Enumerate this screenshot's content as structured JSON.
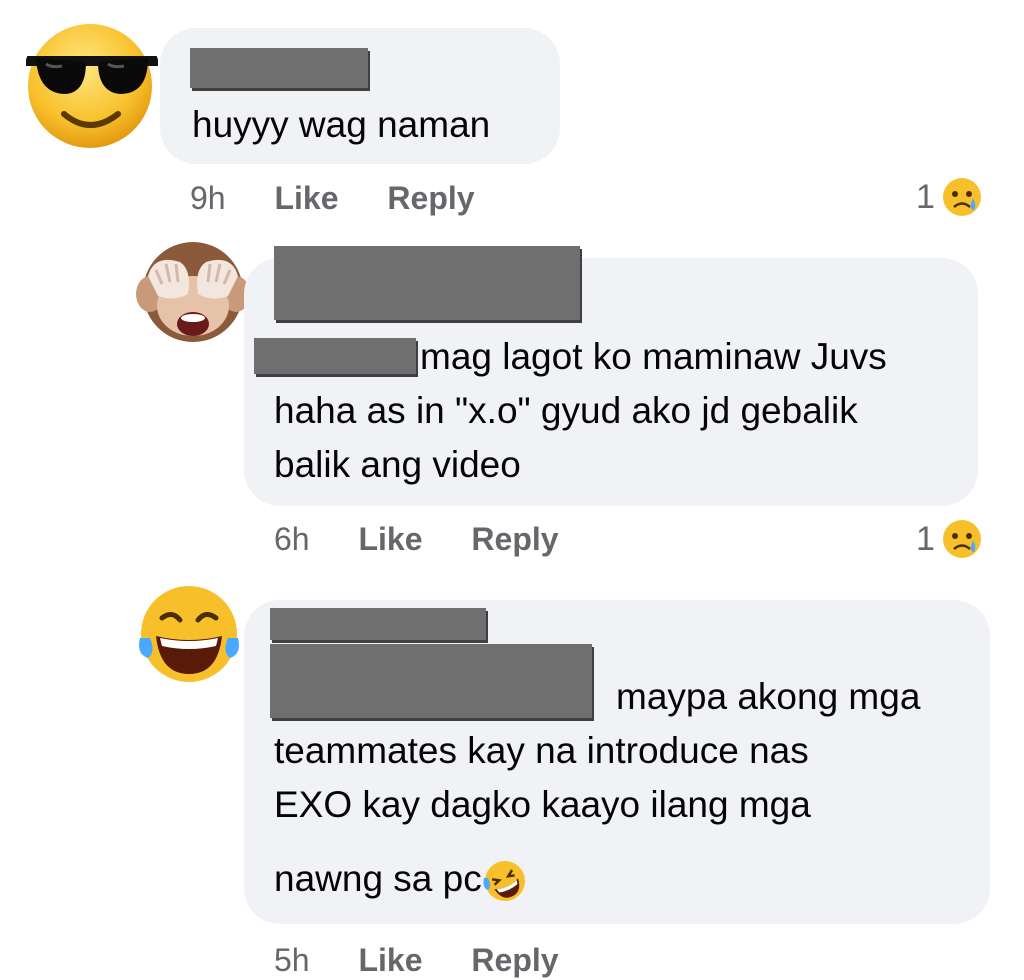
{
  "comments": [
    {
      "text": "huyyy wag naman",
      "time": "9h",
      "like": "Like",
      "reply": "Reply",
      "reaction_count": "1",
      "avatar_icon": "sunglasses-face-icon",
      "reaction_icon": "sad-face-icon"
    },
    {
      "text_line1": "mag lagot ko maminaw Juvs",
      "text_line2": "haha as in \"x.o\" gyud ako jd gebalik",
      "text_line3": "balik ang video",
      "time": "6h",
      "like": "Like",
      "reply": "Reply",
      "reaction_count": "1",
      "avatar_icon": "see-no-evil-monkey-icon",
      "reaction_icon": "sad-face-icon"
    },
    {
      "text_line1": "maypa akong mga",
      "text_line2": "teammates kay na introduce nas",
      "text_line3": "EXO kay dagko kaayo ilang mga",
      "text_line4": "nawng sa pc",
      "time": "5h",
      "like": "Like",
      "reply": "Reply",
      "avatar_icon": "tears-of-joy-icon",
      "inline_icon": "rolling-laughing-icon"
    }
  ],
  "colors": {
    "bubble": "#f0f2f5",
    "meta": "#65676b",
    "redaction": "#6f6f6f"
  }
}
